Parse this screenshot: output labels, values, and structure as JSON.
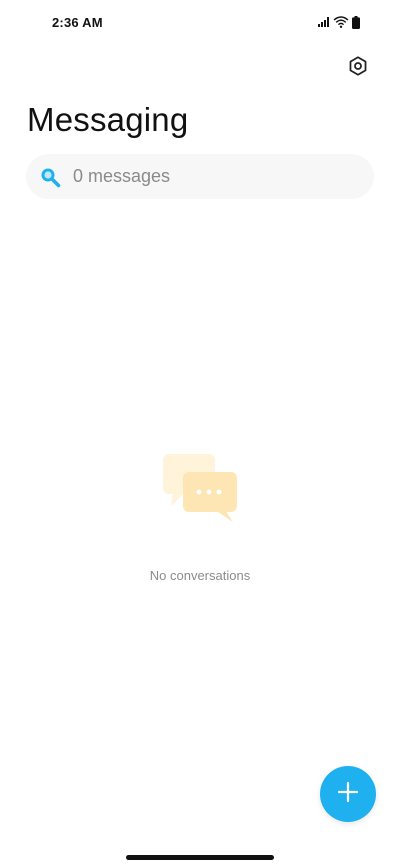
{
  "status_bar": {
    "time": "2:36 AM",
    "icons": [
      "signal-icon",
      "wifi-icon",
      "battery-icon"
    ]
  },
  "header": {
    "title": "Messaging",
    "settings_icon": "gear-icon"
  },
  "search": {
    "icon": "search-icon",
    "placeholder": "0 messages"
  },
  "empty_state": {
    "icon": "chat-bubbles-icon",
    "text": "No conversations"
  },
  "fab": {
    "icon": "plus-icon"
  },
  "colors": {
    "accent": "#1fb0f0",
    "search_bg": "#f7f7f7",
    "empty_icon": "#fde6b3"
  }
}
